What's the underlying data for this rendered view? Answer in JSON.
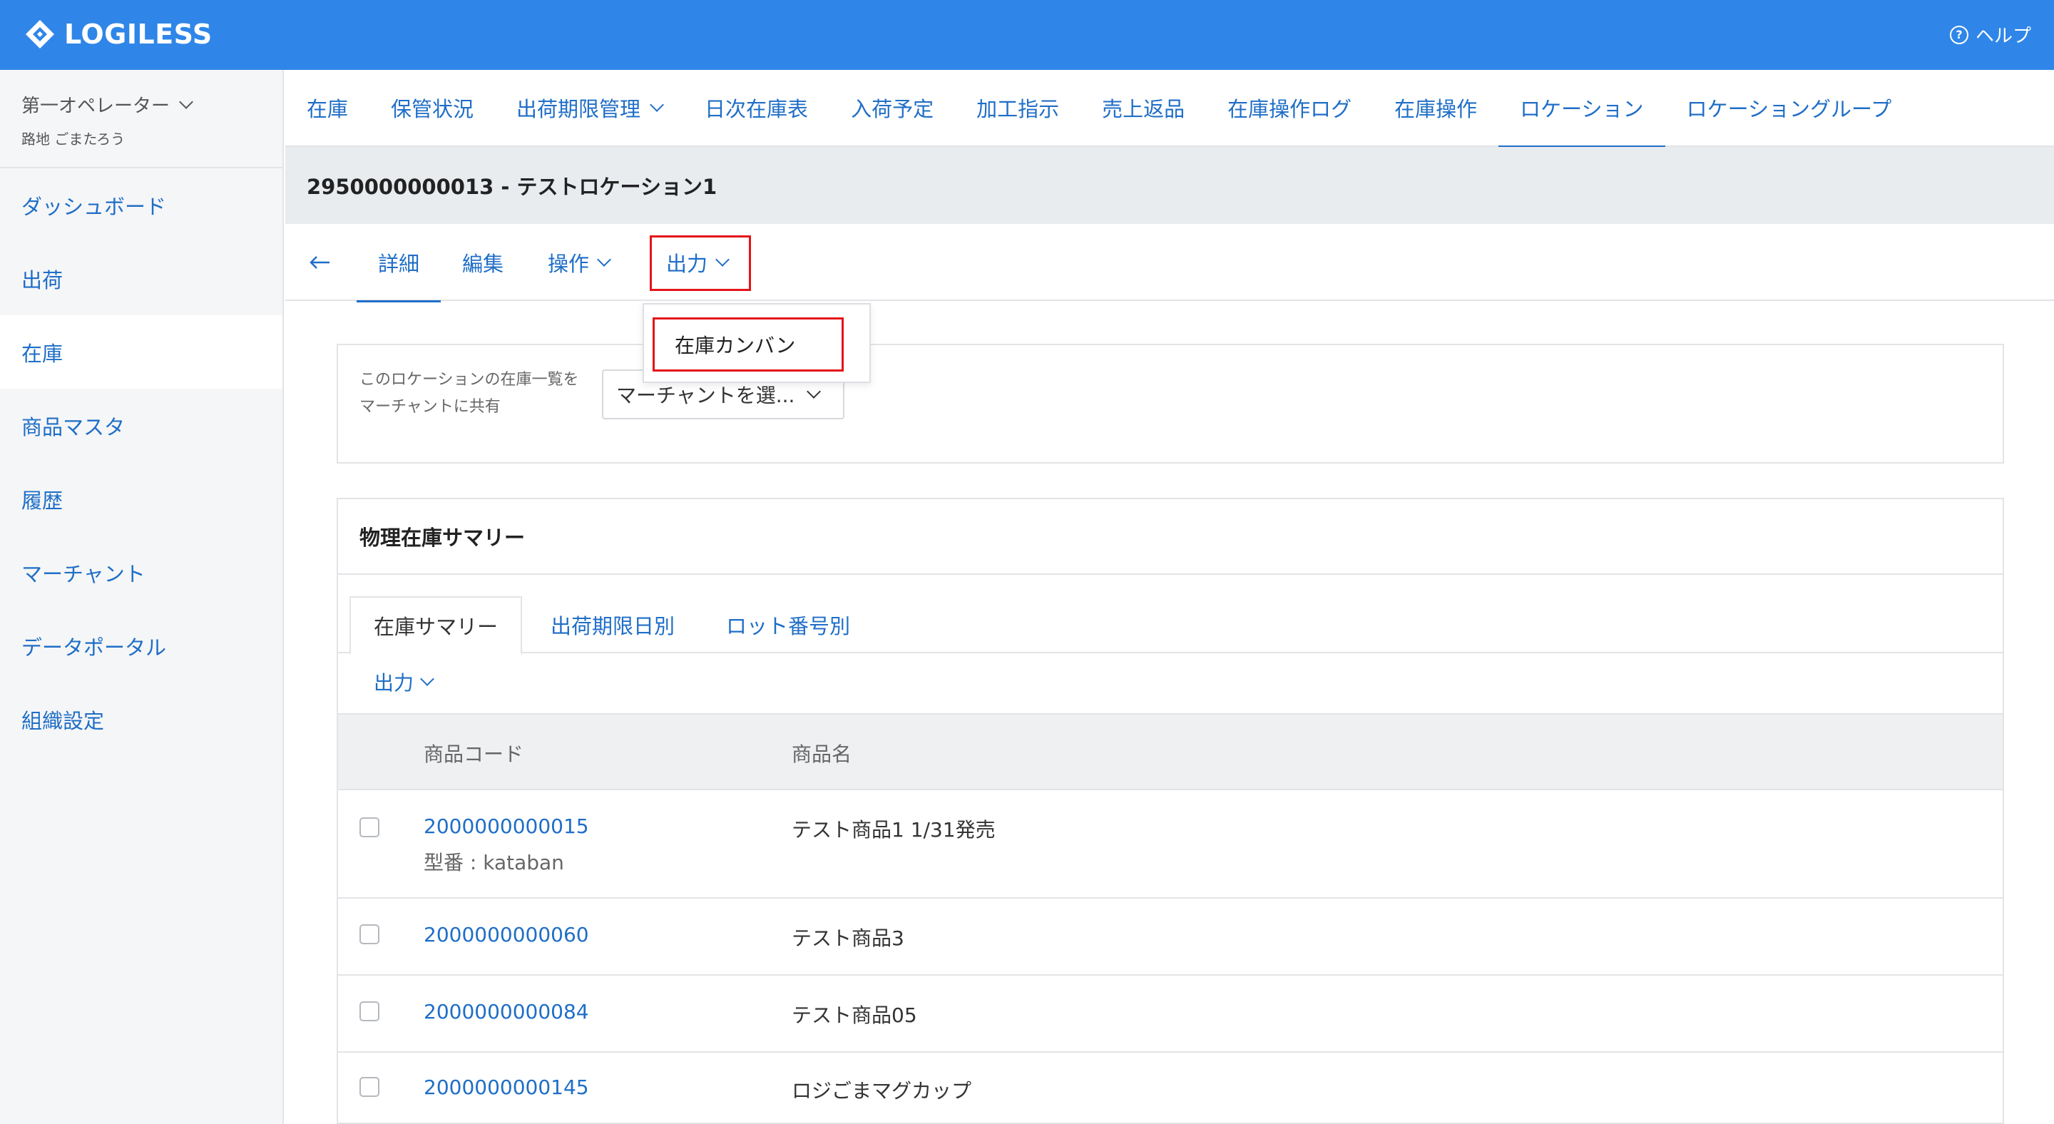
{
  "header": {
    "logo_text": "LOGILESS",
    "help_label": "ヘルプ",
    "brand_color": "#2f86e8"
  },
  "sidebar": {
    "user_name": "第一オペレーター",
    "user_sub": "路地 ごまたろう",
    "items": [
      {
        "label": "ダッシュボード"
      },
      {
        "label": "出荷"
      },
      {
        "label": "在庫",
        "active": true
      },
      {
        "label": "商品マスタ"
      },
      {
        "label": "履歴"
      },
      {
        "label": "マーチャント"
      },
      {
        "label": "データポータル"
      },
      {
        "label": "組織設定"
      }
    ]
  },
  "topnav": {
    "items": [
      {
        "label": "在庫"
      },
      {
        "label": "保管状況"
      },
      {
        "label": "出荷期限管理",
        "dropdown": true
      },
      {
        "label": "日次在庫表"
      },
      {
        "label": "入荷予定"
      },
      {
        "label": "加工指示"
      },
      {
        "label": "売上返品"
      },
      {
        "label": "在庫操作ログ"
      },
      {
        "label": "在庫操作"
      },
      {
        "label": "ロケーション",
        "active": true
      },
      {
        "label": "ロケーショングループ"
      }
    ]
  },
  "page": {
    "title": "2950000000013 - テストロケーション1"
  },
  "subnav": {
    "back_icon": "arrow-left-icon",
    "detail": "詳細",
    "edit": "編集",
    "operation": "操作",
    "output": "出力"
  },
  "dropdown": {
    "item": "在庫カンバン"
  },
  "share": {
    "label_line1": "このロケーションの在庫一覧を",
    "label_line2": "マーチャントに共有",
    "select_value": "マーチャントを選..."
  },
  "summary": {
    "title": "物理在庫サマリー",
    "tabs": [
      "在庫サマリー",
      "出荷期限日別",
      "ロット番号別"
    ],
    "output_label": "出力",
    "columns": [
      "商品コード",
      "商品名"
    ],
    "rows": [
      {
        "code": "2000000000015",
        "sub": "型番 : kataban",
        "name": "テスト商品1 1/31発売"
      },
      {
        "code": "2000000000060",
        "sub": "",
        "name": "テスト商品3"
      },
      {
        "code": "2000000000084",
        "sub": "",
        "name": "テスト商品05"
      },
      {
        "code": "2000000000145",
        "sub": "",
        "name": "ロジごまマグカップ"
      }
    ]
  }
}
